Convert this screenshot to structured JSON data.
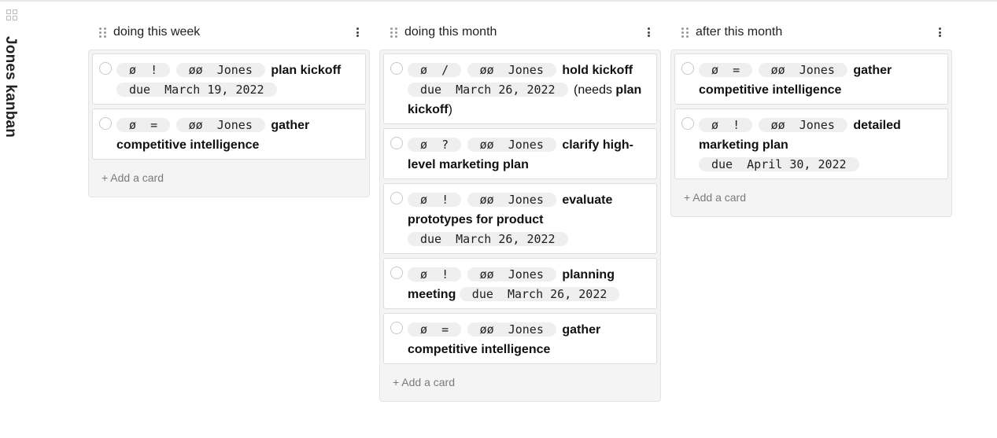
{
  "board": {
    "title": "Jones kanban"
  },
  "columns": [
    {
      "title": "doing this week",
      "add_label": "+ Add a card",
      "cards": [
        {
          "prio": "ø  !",
          "owner": "øø  Jones",
          "title": "plan kickoff",
          "due": "due  March 19, 2022",
          "note": ""
        },
        {
          "prio": "ø  =",
          "owner": "øø  Jones",
          "title": "gather competitive intelligence",
          "due": "",
          "note": ""
        }
      ]
    },
    {
      "title": "doing this month",
      "add_label": "+ Add a card",
      "cards": [
        {
          "prio": "ø  /",
          "owner": "øø  Jones",
          "title": "hold kickoff",
          "due": "due  March 26, 2022",
          "note_open": "(needs",
          "note_link": "plan kickoff",
          "note_close": ")"
        },
        {
          "prio": "ø  ?",
          "owner": "øø  Jones",
          "title": "clarify high-level marketing plan",
          "due": "",
          "note": ""
        },
        {
          "prio": "ø  !",
          "owner": "øø  Jones",
          "title": "evaluate prototypes for product",
          "due": "due  March 26, 2022",
          "note": ""
        },
        {
          "prio": "ø  !",
          "owner": "øø  Jones",
          "title": "planning meeting",
          "due": "due  March 26, 2022",
          "note": ""
        },
        {
          "prio": "ø  =",
          "owner": "øø  Jones",
          "title": "gather competitive intelligence",
          "due": "",
          "note": ""
        }
      ]
    },
    {
      "title": "after this month",
      "add_label": "+ Add a card",
      "cards": [
        {
          "prio": "ø  =",
          "owner": "øø  Jones",
          "title": "gather competitive intelligence",
          "due": "",
          "note": ""
        },
        {
          "prio": "ø  !",
          "owner": "øø  Jones",
          "title": "detailed marketing plan",
          "due": "due  April 30, 2022",
          "note": ""
        }
      ]
    }
  ]
}
